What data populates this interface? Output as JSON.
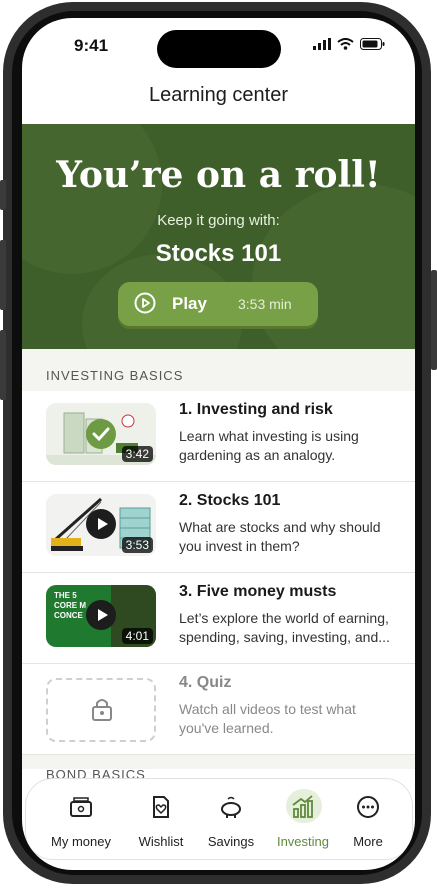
{
  "status": {
    "time": "9:41"
  },
  "header": {
    "title": "Learning center"
  },
  "hero": {
    "title": "You’re on a roll!",
    "subtitle": "Keep it going with:",
    "course": "Stocks 101",
    "play_label": "Play",
    "play_duration": "3:53 min"
  },
  "sections": [
    {
      "label": "INVESTING BASICS",
      "items": [
        {
          "title": "1. Investing and risk",
          "desc": "Learn what investing is using\ngardening as an analogy.",
          "duration": "3:42",
          "state": "completed",
          "thumb_text": ""
        },
        {
          "title": "2. Stocks 101",
          "desc": "What are stocks and why should\nyou invest in them?",
          "duration": "3:53",
          "state": "playable",
          "thumb_text": ""
        },
        {
          "title": "3. Five money musts",
          "desc": "Let’s explore the world of earning,\nspending, saving, investing, and...",
          "duration": "4:01",
          "state": "playable",
          "thumb_text": "THE 5\nCORE M\nCONCE"
        },
        {
          "title": "4. Quiz",
          "desc": "Watch all videos to test what\nyou've learned.",
          "duration": "",
          "state": "locked",
          "thumb_text": ""
        }
      ]
    },
    {
      "label": "BOND BASICS"
    }
  ],
  "tabs": [
    {
      "label": "My money",
      "icon": "wallet-icon",
      "active": false
    },
    {
      "label": "Wishlist",
      "icon": "wishlist-icon",
      "active": false
    },
    {
      "label": "Savings",
      "icon": "piggy-bank-icon",
      "active": false
    },
    {
      "label": "Investing",
      "icon": "chart-icon",
      "active": true
    },
    {
      "label": "More",
      "icon": "more-icon",
      "active": false
    }
  ],
  "colors": {
    "hero_bg": "#3f5f2a",
    "accent": "#78a046",
    "active_tab": "#5f8a3a"
  }
}
